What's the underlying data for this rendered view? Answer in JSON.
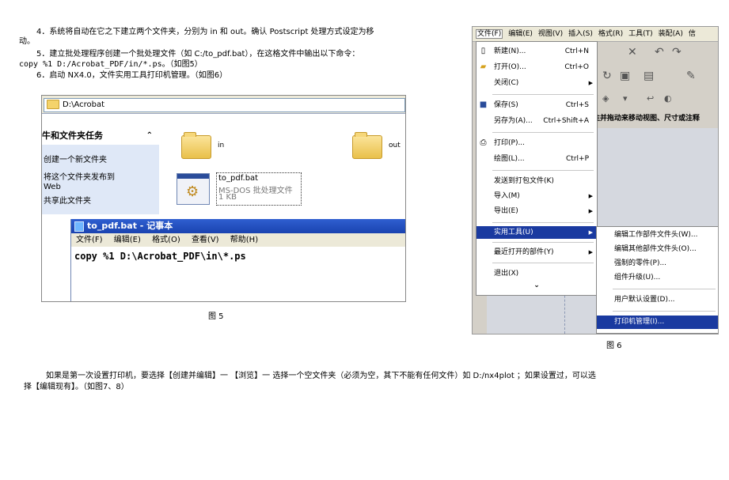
{
  "text": {
    "line1": "4．系统将自动在它之下建立两个文件夹，分别为 in 和 out。确认 Postscript 处理方式设定为移",
    "line1b": "动。",
    "line2": "5．建立批处理程序创建一个批处理文件（如 C:/to_pdf.bat），在这格文件中输出以下命令：",
    "line3": "copy %1 D:/Acrobat_PDF/in/*.ps。（如图5）",
    "line4": "6．启动 NX4.0，文件实用工具打印机管理。（如图6）",
    "caption5": "图 5",
    "caption6": "图 6",
    "para1": "如果是第一次设置打印机，要选择【创建并编辑】一 【浏览】一 选择一个空文件夹（必须为空，其下不能有任何文件）如 D:/nx4plot ；如果设置过，可以选",
    "para2": "择【编辑现有】。（如图7、8）"
  },
  "fig5": {
    "address": "D:\\Acrobat",
    "tasks_header": "牛和文件夹任务",
    "collapse_glyph": "⌃",
    "tasks": [
      "创建一个新文件夹",
      "将这个文件夹发布到",
      "Web",
      "共享此文件夹"
    ],
    "folder_in": "in",
    "folder_out": "out",
    "file_name": "to_pdf.bat",
    "file_type": "MS-DOS 批处理文件",
    "file_size": "1 KB",
    "notepad_title": "to_pdf.bat - 记事本",
    "notepad_menu": [
      "文件(F)",
      "编辑(E)",
      "格式(O)",
      "查看(V)",
      "帮助(H)"
    ],
    "notepad_content": "copy %1 D:\\Acrobat_PDF\\in\\*.ps"
  },
  "fig6": {
    "menubar": [
      "文件(F)",
      "编辑(E)",
      "视图(V)",
      "插入(S)",
      "格式(R)",
      "工具(T)",
      "装配(A)",
      "信"
    ],
    "hint": "注并拖动来移动视图、尺寸或注释",
    "file_menu": [
      {
        "label": "新建(N)...",
        "shortcut": "Ctrl+N",
        "icon": "new-file-icon"
      },
      {
        "label": "打开(O)...",
        "shortcut": "Ctrl+O",
        "icon": "open-folder-icon"
      },
      {
        "label": "关闭(C)",
        "shortcut": "",
        "icon": ""
      },
      {
        "label": "保存(S)",
        "shortcut": "Ctrl+S",
        "icon": "save-icon"
      },
      {
        "label": "另存为(A)...",
        "shortcut": "Ctrl+Shift+A",
        "icon": ""
      },
      {
        "label": "打印(P)...",
        "shortcut": "",
        "icon": "print-icon"
      },
      {
        "label": "绘图(L)...",
        "shortcut": "Ctrl+P",
        "icon": ""
      },
      {
        "label": "发送到打包文件(K)",
        "shortcut": "",
        "icon": ""
      },
      {
        "label": "导入(M)",
        "shortcut": "",
        "icon": ""
      },
      {
        "label": "导出(E)",
        "shortcut": "",
        "icon": ""
      },
      {
        "label": "实用工具(U)",
        "shortcut": "",
        "icon": ""
      },
      {
        "label": "最近打开的部件(Y)",
        "shortcut": "",
        "icon": ""
      },
      {
        "label": "退出(X)",
        "shortcut": "",
        "icon": ""
      }
    ],
    "more_glyph": "⌄",
    "submenu": [
      "编辑工作部件文件头(W)...",
      "编辑其他部件文件头(O)...",
      "强制的零件(P)...",
      "组件升级(U)...",
      "用户默认设置(D)...",
      "打印机管理(I)..."
    ]
  }
}
